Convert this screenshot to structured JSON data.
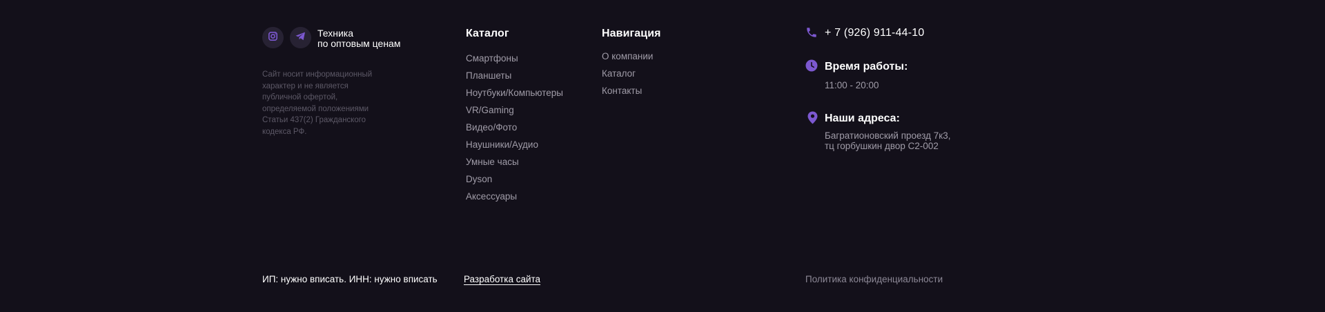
{
  "colors": {
    "background": "#13101a",
    "accent": "#7c58d0",
    "social_bg": "#272233",
    "muted_text": "#a09ca8"
  },
  "brand": {
    "socials": [
      {
        "name": "instagram",
        "icon": "instagram-icon"
      },
      {
        "name": "telegram",
        "icon": "telegram-icon"
      }
    ],
    "tagline_line1": "Техника",
    "tagline_line2": "по оптовым ценам",
    "disclaimer": "Сайт носит информационный характер и не является публичной офертой, определяемой положениями Статьи 437(2) Гражданского кодекса РФ."
  },
  "catalog": {
    "title": "Каталог",
    "items": [
      "Смартфоны",
      "Планшеты",
      "Ноутбуки/Компьютеры",
      "VR/Gaming",
      "Видео/Фото",
      "Наушники/Аудио",
      "Умные часы",
      "Dyson",
      "Аксессуары"
    ]
  },
  "navigation": {
    "title": "Навигация",
    "items": [
      "О компании",
      "Каталог",
      "Контакты"
    ]
  },
  "contacts": {
    "phone": "+ 7 (926) 911-44-10",
    "hours_title": "Время работы:",
    "hours": "11:00 - 20:00",
    "address_title": "Наши адреса:",
    "address_line1": "Багратионовский проезд 7к3,",
    "address_line2": "тц горбушкин двор С2-002"
  },
  "bottom": {
    "legal": "ИП: нужно вписать. ИНН: нужно вписать",
    "dev_link": "Разработка сайта",
    "policy": "Политика конфиденциальности"
  }
}
